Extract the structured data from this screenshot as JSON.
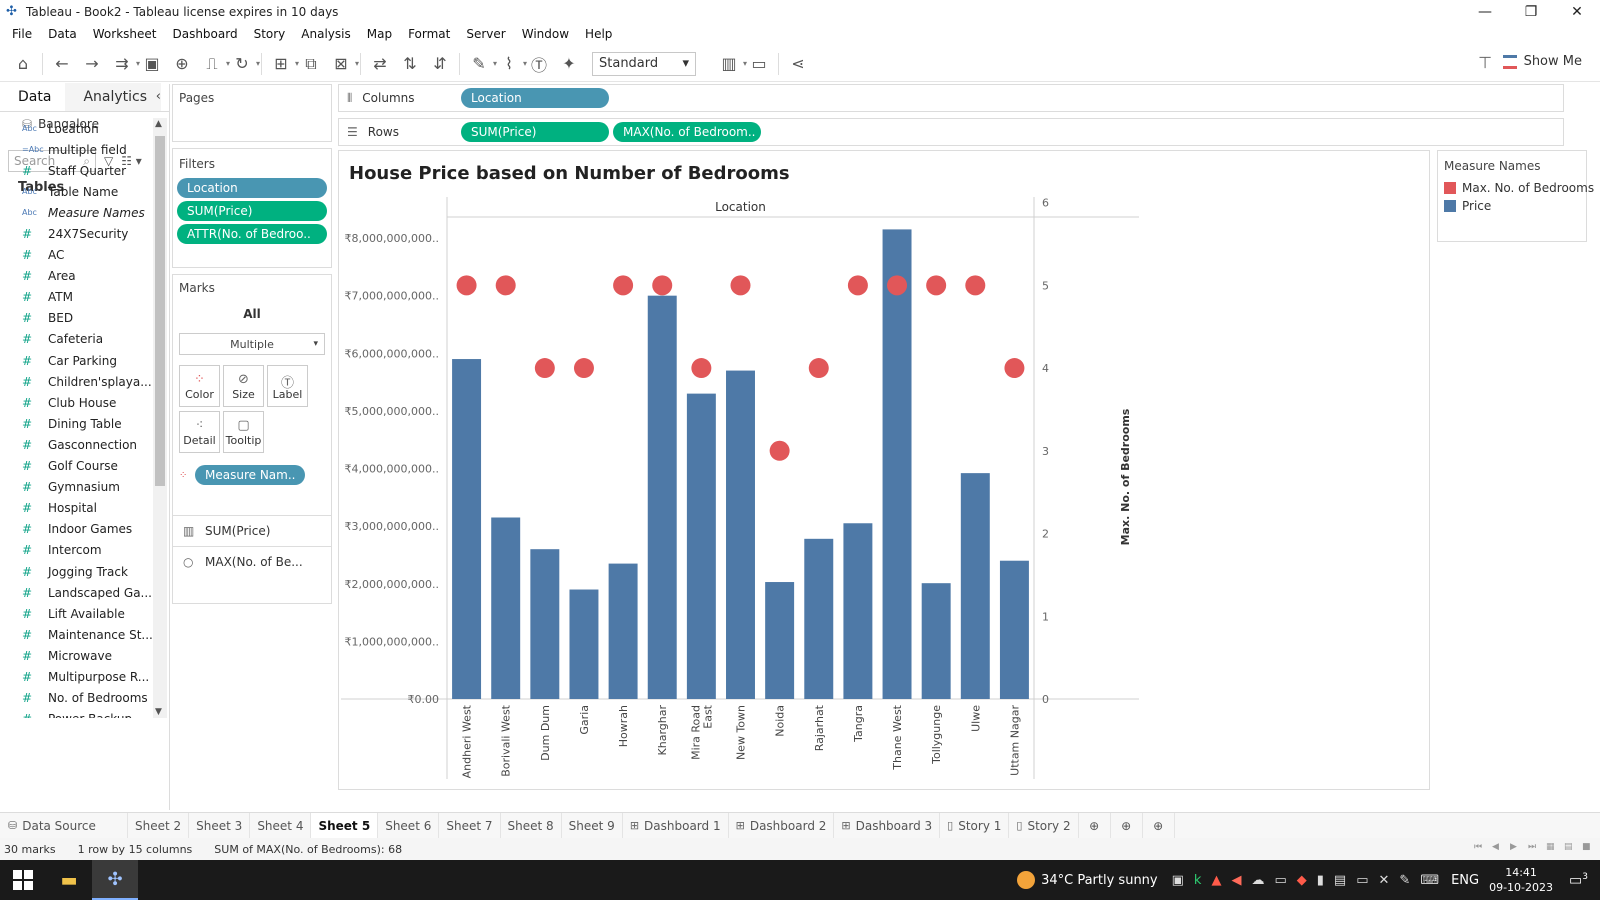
{
  "window": {
    "title": "Tableau - Book2 - Tableau license expires in 10 days",
    "controls": [
      "—",
      "❐",
      "✕"
    ]
  },
  "menu": [
    "File",
    "Data",
    "Worksheet",
    "Dashboard",
    "Story",
    "Analysis",
    "Map",
    "Format",
    "Server",
    "Window",
    "Help"
  ],
  "toolbar": {
    "fit_select": "Standard",
    "show_me": "Show Me"
  },
  "data_pane": {
    "tabs": [
      "Data",
      "Analytics"
    ],
    "datasource": "Bangalore",
    "search_placeholder": "Search",
    "tables_header": "Tables",
    "fields": [
      {
        "type": "Abc",
        "name": "Location",
        "italic": false
      },
      {
        "type": "=Abc",
        "name": "multiple field",
        "italic": false
      },
      {
        "type": "#",
        "name": "Staff Quarter",
        "italic": false
      },
      {
        "type": "Abc",
        "name": "Table Name",
        "italic": false
      },
      {
        "type": "Abc",
        "name": "Measure Names",
        "italic": true
      },
      {
        "type": "#",
        "name": "24X7Security",
        "italic": false
      },
      {
        "type": "#",
        "name": "AC",
        "italic": false
      },
      {
        "type": "#",
        "name": "Area",
        "italic": false
      },
      {
        "type": "#",
        "name": "ATM",
        "italic": false
      },
      {
        "type": "#",
        "name": "BED",
        "italic": false
      },
      {
        "type": "#",
        "name": "Cafeteria",
        "italic": false
      },
      {
        "type": "#",
        "name": "Car Parking",
        "italic": false
      },
      {
        "type": "#",
        "name": "Children'splaya...",
        "italic": false
      },
      {
        "type": "#",
        "name": "Club House",
        "italic": false
      },
      {
        "type": "#",
        "name": "Dining Table",
        "italic": false
      },
      {
        "type": "#",
        "name": "Gasconnection",
        "italic": false
      },
      {
        "type": "#",
        "name": "Golf Course",
        "italic": false
      },
      {
        "type": "#",
        "name": "Gymnasium",
        "italic": false
      },
      {
        "type": "#",
        "name": "Hospital",
        "italic": false
      },
      {
        "type": "#",
        "name": "Indoor Games",
        "italic": false
      },
      {
        "type": "#",
        "name": "Intercom",
        "italic": false
      },
      {
        "type": "#",
        "name": "Jogging Track",
        "italic": false
      },
      {
        "type": "#",
        "name": "Landscaped Ga...",
        "italic": false
      },
      {
        "type": "#",
        "name": "Lift Available",
        "italic": false
      },
      {
        "type": "#",
        "name": "Maintenance St...",
        "italic": false
      },
      {
        "type": "#",
        "name": "Microwave",
        "italic": false
      },
      {
        "type": "#",
        "name": "Multipurpose R...",
        "italic": false
      },
      {
        "type": "#",
        "name": "No. of Bedrooms",
        "italic": false
      },
      {
        "type": "#",
        "name": "Power Backup",
        "italic": false
      }
    ]
  },
  "pages": {
    "title": "Pages"
  },
  "filters": {
    "title": "Filters",
    "pills": [
      {
        "label": "Location",
        "color": "blue"
      },
      {
        "label": "SUM(Price)",
        "color": "green"
      },
      {
        "label": "ATTR(No. of Bedroo..",
        "color": "green"
      }
    ]
  },
  "marks": {
    "title": "Marks",
    "all_label": "All",
    "type_select": "Multiple",
    "buttons": [
      "Color",
      "Size",
      "Label",
      "Detail",
      "Tooltip"
    ],
    "measure_pill": "Measure Nam..",
    "sub": [
      {
        "icon": "bar-icon",
        "label": "SUM(Price)"
      },
      {
        "icon": "circle-icon",
        "label": "MAX(No. of Be..."
      }
    ]
  },
  "shelves": {
    "columns_label": "Columns",
    "columns_pill": "Location",
    "rows_label": "Rows",
    "rows_pills": [
      "SUM(Price)",
      "MAX(No. of Bedroom.."
    ]
  },
  "chart_data": {
    "type": "bar",
    "title": "House Price based on Number of Bedrooms",
    "header_label": "Location",
    "categories": [
      "Andheri West",
      "Borivali West",
      "Dum Dum",
      "Garia",
      "Howrah",
      "Kharghar",
      "Mira Road East",
      "New Town",
      "Noida",
      "Rajarhat",
      "Tangra",
      "Thane West",
      "Tollygunge",
      "Ulwe",
      "Uttam Nagar"
    ],
    "series": [
      {
        "name": "Price",
        "type": "bar",
        "axis": "left",
        "color": "#4e79a7",
        "values": [
          5900000000,
          3150000000,
          2600000000,
          1900000000,
          2350000000,
          7000000000,
          5300000000,
          5700000000,
          2030000000,
          2780000000,
          3050000000,
          8150000000,
          2010000000,
          3920000000,
          2400000000
        ]
      },
      {
        "name": "Max. No. of Bedrooms",
        "type": "circle",
        "axis": "right",
        "color": "#e15759",
        "values": [
          5,
          5,
          4,
          4,
          5,
          5,
          4,
          5,
          3,
          4,
          5,
          5,
          5,
          5,
          4
        ]
      }
    ],
    "y_left": {
      "ticks": [
        "₹0.00",
        "₹1,000,000,000..",
        "₹2,000,000,000..",
        "₹3,000,000,000..",
        "₹4,000,000,000..",
        "₹5,000,000,000..",
        "₹6,000,000,000..",
        "₹7,000,000,000..",
        "₹8,000,000,000.."
      ],
      "ylim": [
        0,
        8400000000
      ]
    },
    "y_right": {
      "label": "Max. No. of Bedrooms",
      "ticks": [
        0,
        1,
        2,
        3,
        4,
        5,
        6
      ],
      "ylim": [
        0,
        5.85
      ]
    },
    "grid": false
  },
  "legend": {
    "title": "Measure Names",
    "items": [
      {
        "label": "Max. No. of Bedrooms",
        "color": "#e15759"
      },
      {
        "label": "Price",
        "color": "#4e79a7"
      }
    ]
  },
  "sheet_tabs": {
    "datasource": "Data Source",
    "tabs": [
      {
        "label": "Sheet 2",
        "kind": "sheet"
      },
      {
        "label": "Sheet 3",
        "kind": "sheet"
      },
      {
        "label": "Sheet 4",
        "kind": "sheet"
      },
      {
        "label": "Sheet 5",
        "kind": "sheet",
        "active": true
      },
      {
        "label": "Sheet 6",
        "kind": "sheet"
      },
      {
        "label": "Sheet 7",
        "kind": "sheet"
      },
      {
        "label": "Sheet 8",
        "kind": "sheet"
      },
      {
        "label": "Sheet 9",
        "kind": "sheet"
      },
      {
        "label": "Dashboard 1",
        "kind": "dashboard"
      },
      {
        "label": "Dashboard 2",
        "kind": "dashboard"
      },
      {
        "label": "Dashboard 3",
        "kind": "dashboard"
      },
      {
        "label": "Story 1",
        "kind": "story"
      },
      {
        "label": "Story 2",
        "kind": "story"
      }
    ]
  },
  "status": {
    "marks": "30 marks",
    "layout": "1 row by 15 columns",
    "sum": "SUM of MAX(No. of Bedrooms): 68"
  },
  "taskbar": {
    "weather": "34°C Partly sunny",
    "lang": "ENG",
    "time": "14:41",
    "date": "09-10-2023",
    "notif_count": "3"
  }
}
